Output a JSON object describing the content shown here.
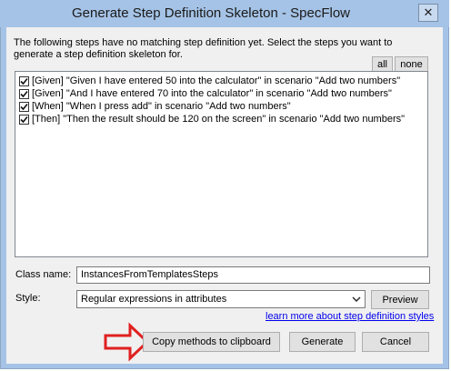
{
  "window": {
    "title": "Generate Step Definition Skeleton - SpecFlow",
    "close_glyph": "✕"
  },
  "description": "The following steps have no matching step definition yet. Select the steps you want to generate a step definition skeleton for.",
  "select_buttons": {
    "all": "all",
    "none": "none"
  },
  "steps": [
    {
      "text": "[Given] \"Given I have entered 50 into the calculator\" in scenario \"Add two numbers\"",
      "checked": true
    },
    {
      "text": "[Given] \"And I have entered 70 into the calculator\" in scenario \"Add two numbers\"",
      "checked": true
    },
    {
      "text": "[When] \"When I press add\" in scenario \"Add two numbers\"",
      "checked": true
    },
    {
      "text": "[Then] \"Then the result should be 120 on the screen\" in scenario \"Add two numbers\"",
      "checked": true
    }
  ],
  "class_name": {
    "label": "Class name:",
    "value": "InstancesFromTemplatesSteps"
  },
  "style": {
    "label": "Style:",
    "value": "Regular expressions in attributes",
    "preview_label": "Preview"
  },
  "learn_more_link": "learn more about step definition styles",
  "buttons": {
    "copy": "Copy methods to clipboard",
    "generate": "Generate",
    "cancel": "Cancel"
  },
  "colors": {
    "titlebar": "#a5c3e6",
    "annotation_arrow": "#e02020",
    "link": "#0000ee"
  }
}
